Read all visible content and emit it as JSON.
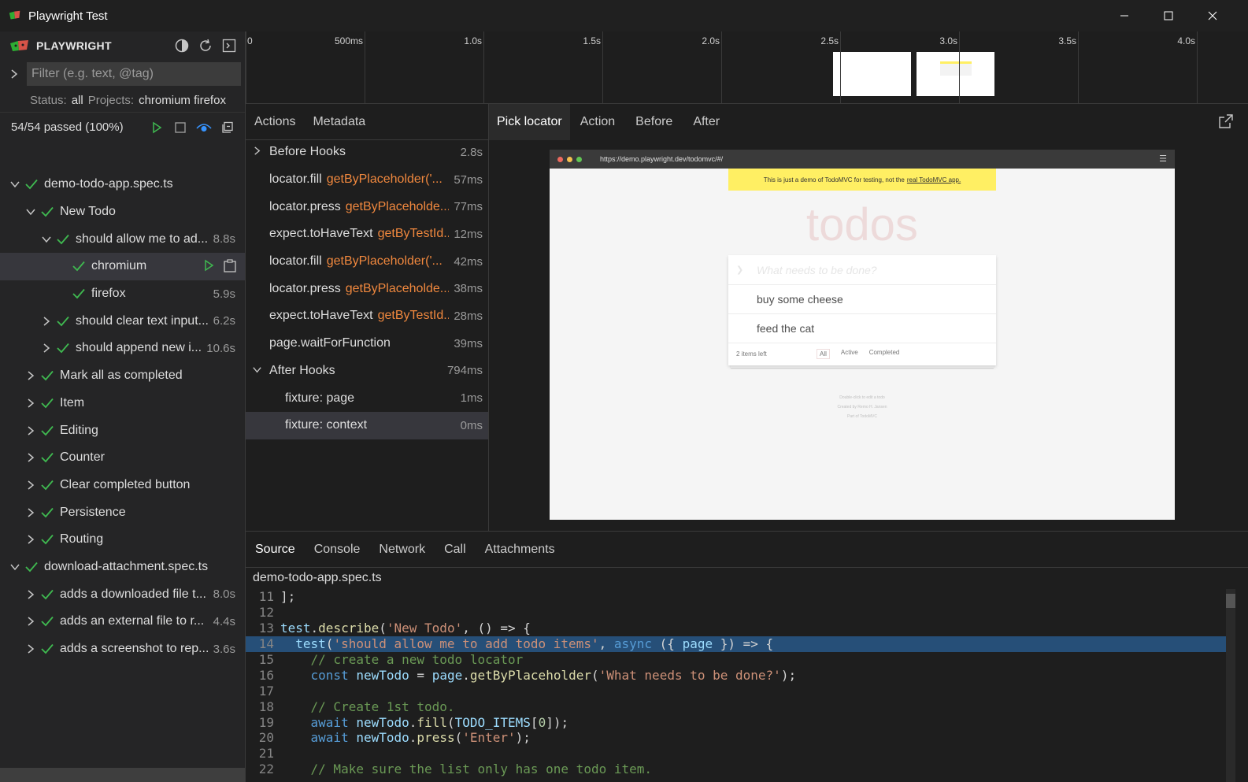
{
  "window": {
    "title": "Playwright Test"
  },
  "sidebar": {
    "brand": "PLAYWRIGHT",
    "filter_placeholder": "Filter (e.g. text, @tag)",
    "status_label": "Status:",
    "status_value": "all",
    "projects_label": "Projects:",
    "projects_value": "chromium firefox",
    "passed_summary": "54/54 passed (100%)",
    "tree": [
      {
        "label": "demo-todo-app.spec.ts",
        "indent": 0,
        "chevron": "down",
        "duration": ""
      },
      {
        "label": "New Todo",
        "indent": 1,
        "chevron": "down",
        "duration": ""
      },
      {
        "label": "should allow me to ad...",
        "indent": 2,
        "chevron": "down",
        "duration": "8.8s"
      },
      {
        "label": "chromium",
        "indent": 3,
        "chevron": "none",
        "duration": "",
        "selected": true
      },
      {
        "label": "firefox",
        "indent": 3,
        "chevron": "none",
        "duration": "5.9s"
      },
      {
        "label": "should clear text input...",
        "indent": 2,
        "chevron": "right",
        "duration": "6.2s"
      },
      {
        "label": "should append new i...",
        "indent": 2,
        "chevron": "right",
        "duration": "10.6s"
      },
      {
        "label": "Mark all as completed",
        "indent": 1,
        "chevron": "right",
        "duration": ""
      },
      {
        "label": "Item",
        "indent": 1,
        "chevron": "right",
        "duration": ""
      },
      {
        "label": "Editing",
        "indent": 1,
        "chevron": "right",
        "duration": ""
      },
      {
        "label": "Counter",
        "indent": 1,
        "chevron": "right",
        "duration": ""
      },
      {
        "label": "Clear completed button",
        "indent": 1,
        "chevron": "right",
        "duration": ""
      },
      {
        "label": "Persistence",
        "indent": 1,
        "chevron": "right",
        "duration": ""
      },
      {
        "label": "Routing",
        "indent": 1,
        "chevron": "right",
        "duration": ""
      },
      {
        "label": "download-attachment.spec.ts",
        "indent": 0,
        "chevron": "down",
        "duration": ""
      },
      {
        "label": "adds a downloaded file t...",
        "indent": 1,
        "chevron": "right",
        "duration": "8.0s"
      },
      {
        "label": "adds an external file to r...",
        "indent": 1,
        "chevron": "right",
        "duration": "4.4s"
      },
      {
        "label": "adds a screenshot to rep...",
        "indent": 1,
        "chevron": "right",
        "duration": "3.6s"
      }
    ]
  },
  "timeline": {
    "ticks": [
      "0",
      "500ms",
      "1.0s",
      "1.5s",
      "2.0s",
      "2.5s",
      "3.0s",
      "3.5s",
      "4.0s"
    ]
  },
  "actions_panel": {
    "tabs": [
      "Actions",
      "Metadata"
    ],
    "rows": [
      {
        "name": "Before Hooks",
        "selector": "",
        "duration": "2.8s",
        "chevron": "right",
        "indent": 0
      },
      {
        "name": "locator.fill",
        "selector": "getByPlaceholder('...",
        "duration": "57ms",
        "chevron": "none",
        "indent": 0
      },
      {
        "name": "locator.press",
        "selector": "getByPlaceholde...",
        "duration": "77ms",
        "chevron": "none",
        "indent": 0
      },
      {
        "name": "expect.toHaveText",
        "selector": "getByTestId...",
        "duration": "12ms",
        "chevron": "none",
        "indent": 0
      },
      {
        "name": "locator.fill",
        "selector": "getByPlaceholder('...",
        "duration": "42ms",
        "chevron": "none",
        "indent": 0
      },
      {
        "name": "locator.press",
        "selector": "getByPlaceholde...",
        "duration": "38ms",
        "chevron": "none",
        "indent": 0
      },
      {
        "name": "expect.toHaveText",
        "selector": "getByTestId...",
        "duration": "28ms",
        "chevron": "none",
        "indent": 0
      },
      {
        "name": "page.waitForFunction",
        "selector": "",
        "duration": "39ms",
        "chevron": "none",
        "indent": 0
      },
      {
        "name": "After Hooks",
        "selector": "",
        "duration": "794ms",
        "chevron": "down",
        "indent": 0
      },
      {
        "name": "fixture: page",
        "selector": "",
        "duration": "1ms",
        "chevron": "none",
        "indent": 1
      },
      {
        "name": "fixture: context",
        "selector": "",
        "duration": "0ms",
        "chevron": "none",
        "indent": 1,
        "selected": true
      }
    ]
  },
  "preview_panel": {
    "tabs": [
      "Pick locator",
      "Action",
      "Before",
      "After"
    ],
    "url": "https://demo.playwright.dev/todomvc/#/",
    "banner_text": "This is just a demo of TodoMVC for testing, not the",
    "banner_link": "real TodoMVC app.",
    "app_title": "todos",
    "new_todo_placeholder": "What needs to be done?",
    "todo_items": [
      "buy some cheese",
      "feed the cat"
    ],
    "items_left": "2 items left",
    "filters": [
      "All",
      "Active",
      "Completed"
    ],
    "info_lines": [
      "Double-click to edit a todo",
      "Created by Remo H. Jansen",
      "Part of TodoMVC"
    ]
  },
  "bottom_panel": {
    "tabs": [
      "Source",
      "Console",
      "Network",
      "Call",
      "Attachments"
    ],
    "file_name": "demo-todo-app.spec.ts"
  },
  "colors": {
    "pass_green": "#3fb950",
    "selector_orange": "#f0883e",
    "code_highlight": "#264f78",
    "banner_yellow": "#ffef63"
  }
}
